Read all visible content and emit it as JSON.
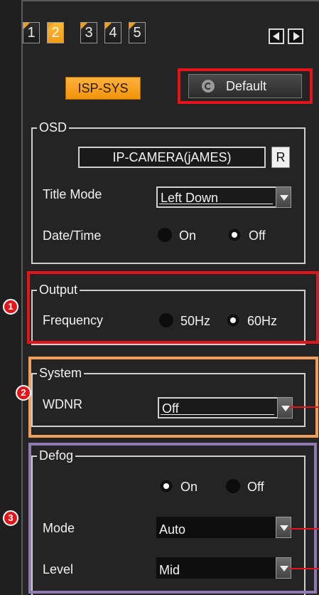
{
  "tabs": [
    "1",
    "2",
    "3",
    "4",
    "5"
  ],
  "active_tab": "2",
  "buttons": {
    "isp_sys": "ISP-SYS",
    "default": "Default",
    "r": "R"
  },
  "osd": {
    "title": "OSD",
    "camera_name": "IP-CAMERA(jAMES)",
    "title_mode_label": "Title Mode",
    "title_mode_value": "Left Down",
    "datetime_label": "Date/Time",
    "on_label": "On",
    "off_label": "Off",
    "datetime_selected": "Off"
  },
  "output": {
    "title": "Output",
    "frequency_label": "Frequency",
    "opt_50": "50Hz",
    "opt_60": "60Hz",
    "selected": "60Hz"
  },
  "system": {
    "title": "System",
    "wdnr_label": "WDNR",
    "wdnr_value": "Off"
  },
  "defog": {
    "title": "Defog",
    "on_label": "On",
    "off_label": "Off",
    "selected": "On",
    "mode_label": "Mode",
    "mode_value": "Auto",
    "level_label": "Level",
    "level_value": "Mid"
  },
  "markers": [
    "1",
    "2",
    "3"
  ],
  "colors": {
    "accent": "#f29a12",
    "highlight_red": "#e3151a",
    "highlight_orange": "#f0a05a",
    "highlight_purple": "#8f7bb0"
  }
}
